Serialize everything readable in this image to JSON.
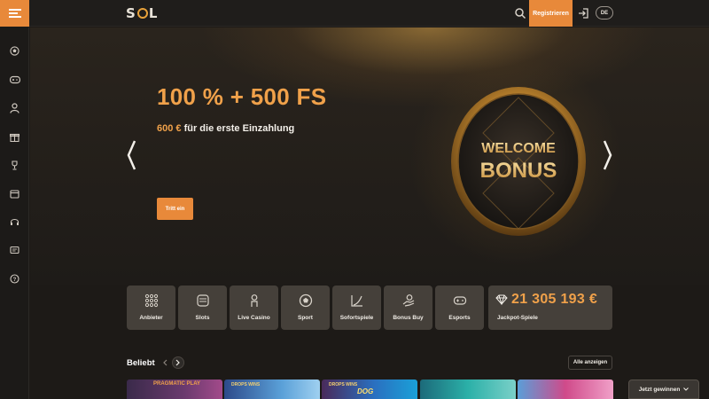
{
  "header": {
    "logo_text_left": "S",
    "logo_text_right": "L",
    "register_label": "Registrieren",
    "language": "DE"
  },
  "sidebar": {
    "items": [
      {
        "icon": "soccer-ball-icon"
      },
      {
        "icon": "gamepad-icon"
      },
      {
        "icon": "dealer-icon"
      },
      {
        "icon": "gift-icon"
      },
      {
        "icon": "trophy-icon"
      },
      {
        "icon": "calendar-icon"
      },
      {
        "icon": "support-headset-icon"
      },
      {
        "icon": "chat-icon"
      },
      {
        "icon": "help-icon"
      }
    ]
  },
  "hero": {
    "title": "100 % + 500 FS",
    "amount": "600 €",
    "subtitle_rest": " für die erste Einzahlung",
    "cta_label": "Tritt ein",
    "coin_line1": "WELCOME",
    "coin_line2": "BONUS"
  },
  "categories": [
    {
      "label": "Anbieter",
      "icon": "grid-dots-icon"
    },
    {
      "label": "Slots",
      "icon": "slot-machine-icon"
    },
    {
      "label": "Live Casino",
      "icon": "dealer-icon"
    },
    {
      "label": "Sport",
      "icon": "soccer-ball-icon"
    },
    {
      "label": "Sofortspiele",
      "icon": "chart-line-icon"
    },
    {
      "label": "Bonus Buy",
      "icon": "hand-coin-icon"
    },
    {
      "label": "Esports",
      "icon": "gamepad-icon"
    }
  ],
  "jackpot": {
    "amount": "21 305 193 €",
    "label": "Jackpot-Spiele"
  },
  "popular": {
    "title": "Beliebt",
    "show_all": "Alle anzeigen",
    "games": [
      {
        "provider": "PRAGMATIC PLAY",
        "badge": "DROPS WINS",
        "title": ""
      },
      {
        "provider": "",
        "badge": "DROPS WINS",
        "title": ""
      },
      {
        "provider": "",
        "badge": "DROPS WINS",
        "title": "DOG"
      },
      {
        "provider": "",
        "badge": "",
        "title": ""
      },
      {
        "provider": "",
        "badge": "",
        "title": ""
      }
    ]
  },
  "win_now_label": "Jetzt gewinnen",
  "colors": {
    "accent": "#e8893a",
    "accent_text": "#f0a14a",
    "tile": "#45403a",
    "background": "#1d1a17"
  }
}
